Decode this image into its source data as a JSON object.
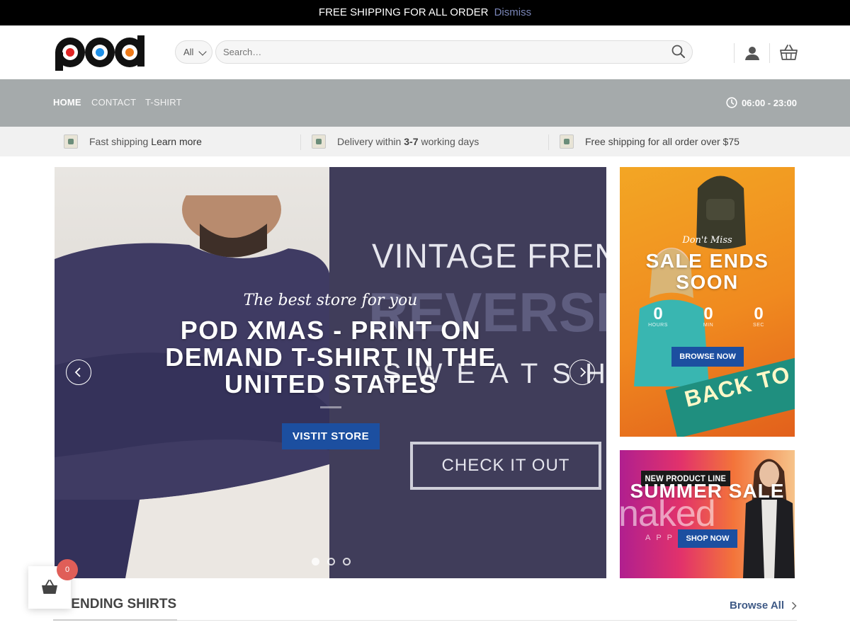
{
  "announcement": {
    "text": "FREE SHIPPING FOR ALL ORDER",
    "dismiss_label": "Dismiss"
  },
  "search": {
    "category_value": "All",
    "placeholder": "Search…"
  },
  "nav": {
    "items": [
      {
        "label": "HOME",
        "active": true
      },
      {
        "label": "CONTACT",
        "active": false
      },
      {
        "label": "T-SHIRT",
        "active": false
      }
    ],
    "hours": "06:00 - 23:00"
  },
  "info_bar": {
    "item1_text": "Fast shipping ",
    "item1_link": "Learn more",
    "item2_pre": "Delivery within ",
    "item2_bold": "3-7",
    "item2_post": " working days",
    "item3_text": "Free shipping for all order over $75"
  },
  "hero": {
    "tagline": "The best store for you",
    "headline": "POD XMAS - PRINT ON DEMAND T-SHIRT IN THE UNITED STATES",
    "button_label": "VISTIT STORE",
    "bg_text_vintage": "VINTAGE FRENCH TER",
    "bg_text_reversible": "REVERSIBLE",
    "bg_text_sweatshirt": "SWEATSHIR",
    "bg_text_check": "CHECK IT OUT",
    "slide_count": 3,
    "active_slide": 1
  },
  "banner_sale": {
    "small_text": "Don't Miss",
    "title": "SALE ENDS SOON",
    "countdown": [
      {
        "value": "0",
        "label": "HOURS"
      },
      {
        "value": "0",
        "label": "MIN"
      },
      {
        "value": "0",
        "label": "SEC"
      }
    ],
    "button_label": "BROWSE NOW",
    "ribbon_text": "BACK TO"
  },
  "banner_summer": {
    "tag": "NEW PRODUCT LINE",
    "title": "SUMMER SALE",
    "bg_brand": "naked",
    "bg_sub": "APP",
    "button_label": "SHOP NOW"
  },
  "section": {
    "title": "TRENDING SHIRTS",
    "browse_all": "Browse All"
  },
  "mini_cart": {
    "count": "0"
  },
  "colors": {
    "accent_blue": "#1c4fa0",
    "navbar_gray": "#a5aaab",
    "badge_red": "#e05e58"
  }
}
